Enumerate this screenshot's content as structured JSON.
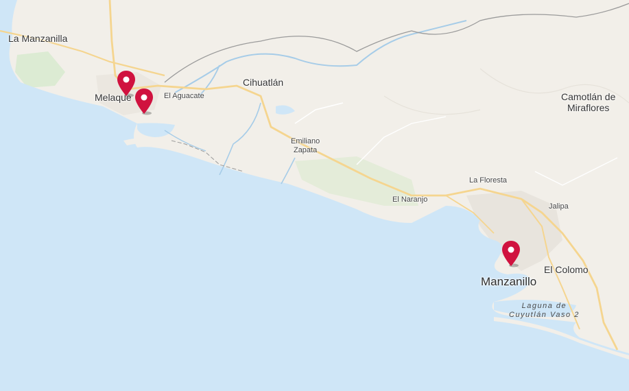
{
  "map": {
    "place_labels": [
      {
        "id": "la-manzanilla",
        "text": "La Manzanilla"
      },
      {
        "id": "melaque",
        "text": "Melaque"
      },
      {
        "id": "el-aguacate",
        "text": "El Aguacate"
      },
      {
        "id": "cihuatlan",
        "text": "Cihuatlán"
      },
      {
        "id": "emiliano-zapata",
        "text": "Emiliano\nZapata"
      },
      {
        "id": "camotlan",
        "text": "Camotlán de\nMiraflores"
      },
      {
        "id": "la-floresta",
        "text": "La Floresta"
      },
      {
        "id": "el-naranjo",
        "text": "El Naranjo"
      },
      {
        "id": "jalipa",
        "text": "Jalipa"
      },
      {
        "id": "el-colomo",
        "text": "El Colomo"
      },
      {
        "id": "manzanillo",
        "text": "Manzanillo"
      },
      {
        "id": "laguna-cuyutlan",
        "text": "Laguna de\nCuyutlán Vaso 2"
      }
    ],
    "markers": [
      {
        "id": "marker-melaque-1",
        "color": "#d0123f"
      },
      {
        "id": "marker-melaque-2",
        "color": "#d0123f"
      },
      {
        "id": "marker-manzanillo",
        "color": "#d0123f"
      }
    ],
    "colors": {
      "ocean": "#cfe6f7",
      "land": "#f2efe9",
      "green": "#dcebd3",
      "road": "#f5d58f",
      "river": "#a6cce8",
      "border": "#9a9a9a"
    }
  }
}
